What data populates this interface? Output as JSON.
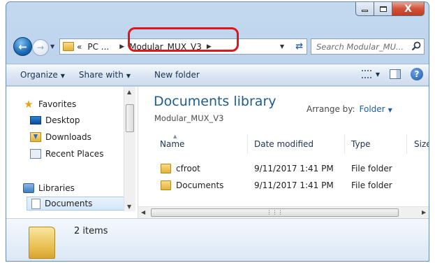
{
  "titlebar": {
    "close_glyph": "X"
  },
  "address": {
    "overflow": "«",
    "segments": [
      "PC ...",
      "Modular_MUX_V3"
    ],
    "search_placeholder": "Search Modular_MU..."
  },
  "toolbar": {
    "organize": "Organize",
    "share_with": "Share with",
    "new_folder": "New folder"
  },
  "nav": {
    "favorites": "Favorites",
    "desktop": "Desktop",
    "downloads": "Downloads",
    "recent_places": "Recent Places",
    "libraries": "Libraries",
    "documents": "Documents"
  },
  "library": {
    "title": "Documents library",
    "subtitle": "Modular_MUX_V3",
    "arrange_label": "Arrange by:",
    "arrange_value": "Folder"
  },
  "columns": {
    "name": "Name",
    "date": "Date modified",
    "type": "Type",
    "size": "Size"
  },
  "files": [
    {
      "name": "cfroot",
      "date": "9/11/2017 1:41 PM",
      "type": "File folder"
    },
    {
      "name": "Documents",
      "date": "9/11/2017 1:41 PM",
      "type": "File folder"
    }
  ],
  "details": {
    "count": "2 items"
  },
  "colors": {
    "highlight": "#e3141b",
    "library_title": "#1e5d8c",
    "accent_link": "#1e5aa8"
  }
}
